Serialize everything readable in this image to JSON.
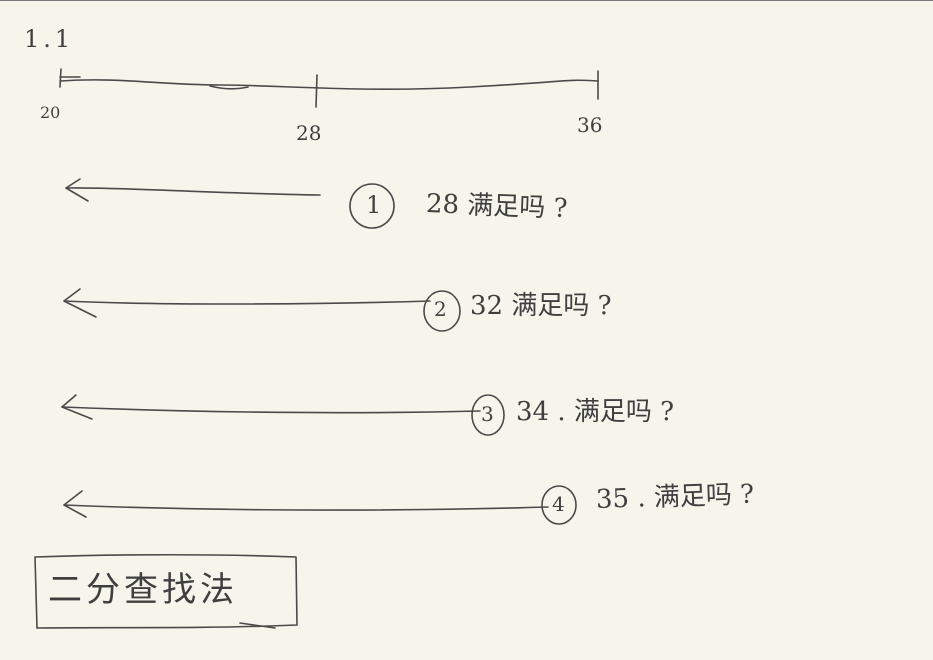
{
  "section_label": "1.1",
  "number_line": {
    "left_value": "20",
    "mid_value": "28",
    "right_value": "36"
  },
  "steps": [
    {
      "marker": "1",
      "text": "28 满足吗 ?"
    },
    {
      "marker": "2",
      "text": "32 满足吗 ?"
    },
    {
      "marker": "3",
      "text": "34 . 满足吗 ?"
    },
    {
      "marker": "4",
      "text": "35 . 满足吗 ?"
    }
  ],
  "boxed_note": "二分查找法",
  "colors": {
    "paper": "#f5f5ec",
    "ink": "#3f3f3f"
  }
}
